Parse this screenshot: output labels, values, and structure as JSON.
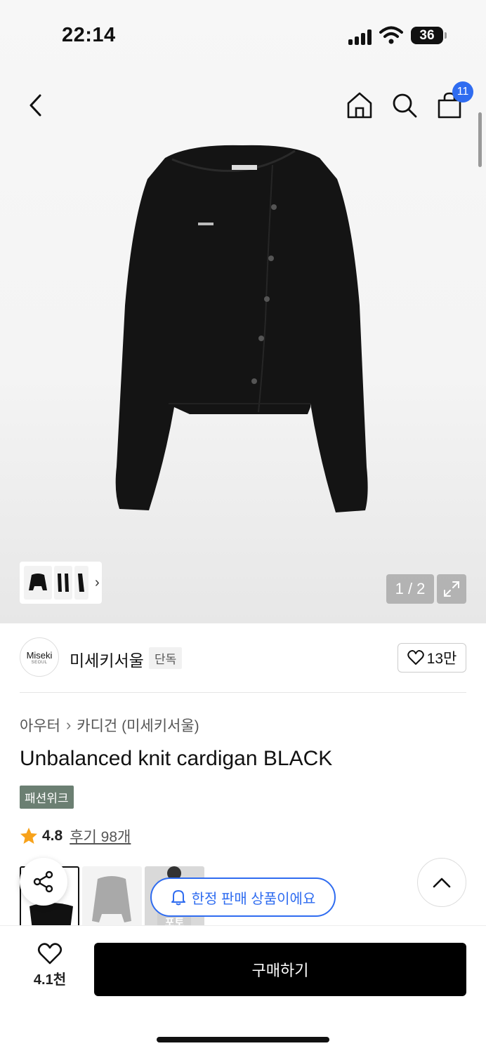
{
  "status_bar": {
    "time": "22:14",
    "battery": "36"
  },
  "nav": {
    "cart_count": "11"
  },
  "gallery": {
    "counter": "1 / 2"
  },
  "brand": {
    "logo_line1": "Miseki",
    "logo_line2": "SEOUL",
    "name": "미세키서울",
    "tag": "단독",
    "likes": "13만"
  },
  "breadcrumb": {
    "category": "아우터",
    "subcategory": "카디건 (미세키서울)"
  },
  "product": {
    "title": "Unbalanced knit cardigan BLACK",
    "badge": "패션위크"
  },
  "rating": {
    "score": "4.8",
    "reviews": "후기 98개"
  },
  "review_thumbs": {
    "caption": "포토"
  },
  "notice": {
    "limited": "한정 판매 상품이에요"
  },
  "bottom": {
    "wish_count": "4.1천",
    "buy_label": "구매하기"
  },
  "colors": {
    "accent_blue": "#2f6cf0",
    "badge_green": "#6b7f72",
    "star": "#f7a21b"
  }
}
